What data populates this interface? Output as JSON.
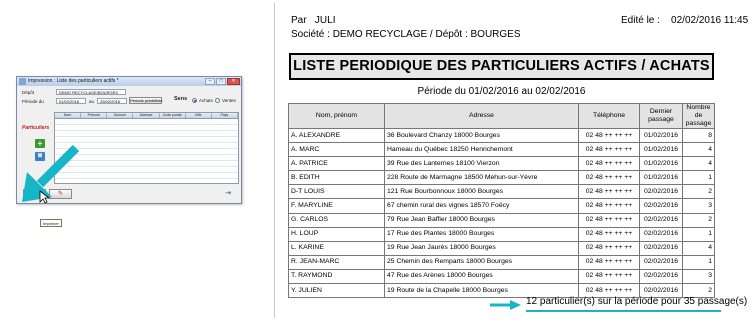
{
  "dialog": {
    "title": "Impression : Liste des particuliers actifs *",
    "depot_label": "Dépôt",
    "depot_value": "DEMO RECYCLAGE/BOURGES",
    "periode_label": "Période du",
    "date_from": "01/02/2016",
    "au_label": "au",
    "date_to": "29/02/2016",
    "period_button": "Période prédéfinie",
    "sens_label": "Sens",
    "sens_options": [
      "Achats",
      "Ventes"
    ],
    "particuliers_label": "Particuliers",
    "columns": [
      "Nom",
      "Prénom",
      "Surnom",
      "Adresse",
      "Code postal",
      "Ville",
      "Pays"
    ],
    "tooltip": "Imprimer",
    "accent_arrow_color": "#17b5c8"
  },
  "report": {
    "par_label": "Par",
    "par_value": "JULI",
    "company_line": "Société : DEMO RECYCLAGE / Dépôt : BOURGES",
    "edited_label": "Edité le :",
    "edited_value": "02/02/2016 11:45",
    "title": "LISTE PERIODIQUE DES PARTICULIERS ACTIFS / ACHATS",
    "period": "Période du 01/02/2016 au 02/02/2016",
    "columns": {
      "name": "Nom, prénom",
      "address": "Adresse",
      "phone": "Téléphone",
      "last": "Dernier passage",
      "count": "Nombre de passage"
    },
    "rows": [
      {
        "name": "A. ALEXANDRE",
        "address": "36 Boulevard Chanzy 18000 Bourges",
        "phone": "02 48 ++ ++ ++",
        "last": "01/02/2016",
        "count": "8"
      },
      {
        "name": "A. MARC",
        "address": "Hameau du Québec 18250 Henrichemont",
        "phone": "02 48 ++ ++ ++",
        "last": "01/02/2016",
        "count": "4"
      },
      {
        "name": "A. PATRICE",
        "address": "39 Rue des Lanternes 18100 Vierzon",
        "phone": "02 48 ++ ++ ++",
        "last": "01/02/2016",
        "count": "4"
      },
      {
        "name": "B. EDITH",
        "address": "228 Route de Marmagne 18500 Mehun-sur-Yèvre",
        "phone": "02 48 ++ ++ ++",
        "last": "01/02/2016",
        "count": "1"
      },
      {
        "name": "D-T LOUIS",
        "address": "121 Rue Bourbonnoux 18000 Bourges",
        "phone": "02 48 ++ ++ ++",
        "last": "02/02/2016",
        "count": "2"
      },
      {
        "name": "F. MARYLINE",
        "address": "67 chemin rural des vignes 18570 Foëcy",
        "phone": "02 48 ++ ++ ++",
        "last": "02/02/2016",
        "count": "3"
      },
      {
        "name": "G. CARLOS",
        "address": "79 Rue Jean Baffier 18000 Bourges",
        "phone": "02 48 ++ ++ ++",
        "last": "02/02/2016",
        "count": "2"
      },
      {
        "name": "H. LOUP",
        "address": "17 Rue des Plantes 18000 Bourges",
        "phone": "02 48 ++ ++ ++",
        "last": "02/02/2016",
        "count": "1"
      },
      {
        "name": "L. KARINE",
        "address": "19 Rue Jean Jaurès 18000 Bourges",
        "phone": "02 48 ++ ++ ++",
        "last": "02/02/2016",
        "count": "4"
      },
      {
        "name": "R. JEAN-MARC",
        "address": "25 Chemin des Remparts 18000 Bourges",
        "phone": "02 48 ++ ++ ++",
        "last": "02/02/2016",
        "count": "1"
      },
      {
        "name": "T. RAYMOND",
        "address": "47 Rue des Arènes 18000 Bourges",
        "phone": "02 48 ++ ++ ++",
        "last": "02/02/2016",
        "count": "3"
      },
      {
        "name": "Y. JULIEN",
        "address": "19 Route de la Chapelle 18000 Bourges",
        "phone": "02 48 ++ ++ ++",
        "last": "02/02/2016",
        "count": "2"
      }
    ],
    "summary": "12 particulier(s) sur la période pour 35 passage(s)"
  }
}
